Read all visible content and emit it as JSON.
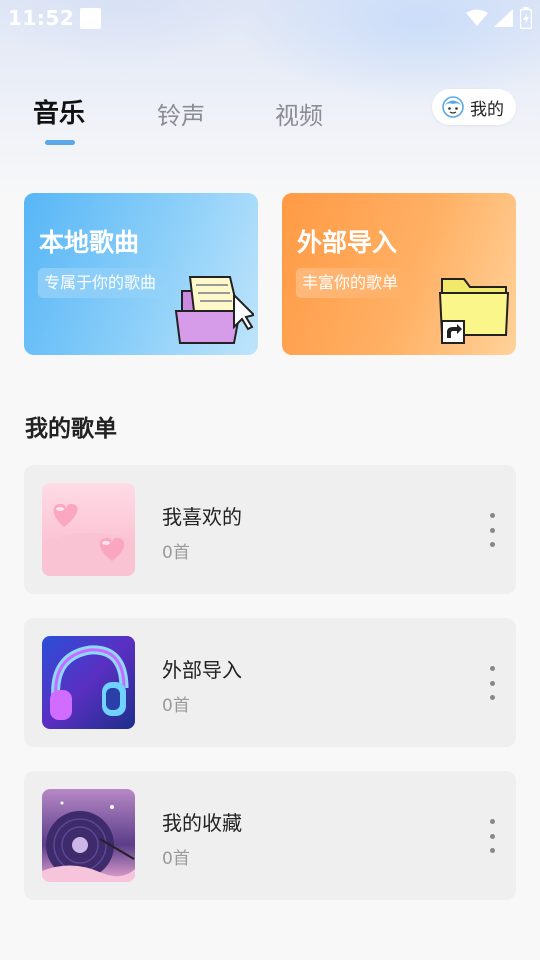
{
  "status_bar": {
    "time": "11:52"
  },
  "tabs": [
    {
      "label": "音乐",
      "active": true
    },
    {
      "label": "铃声",
      "active": false
    },
    {
      "label": "视频",
      "active": false
    }
  ],
  "me_button": {
    "label": "我的",
    "icon": "face-icon"
  },
  "cards": {
    "local": {
      "title": "本地歌曲",
      "subtitle": "专属于你的歌曲",
      "icon": "folder-music-icon"
    },
    "import": {
      "title": "外部导入",
      "subtitle": "丰富你的歌单",
      "icon": "folder-shortcut-icon"
    }
  },
  "section": {
    "title": "我的歌单"
  },
  "playlists": [
    {
      "name": "我喜欢的",
      "count": "0首",
      "cover": "hearts-cover"
    },
    {
      "name": "外部导入",
      "count": "0首",
      "cover": "headphones-cover"
    },
    {
      "name": "我的收藏",
      "count": "0首",
      "cover": "vinyl-cover"
    }
  ],
  "colors": {
    "accent": "#5aa8ea",
    "local_card": "#57b6f6",
    "import_card": "#ff9a45"
  }
}
